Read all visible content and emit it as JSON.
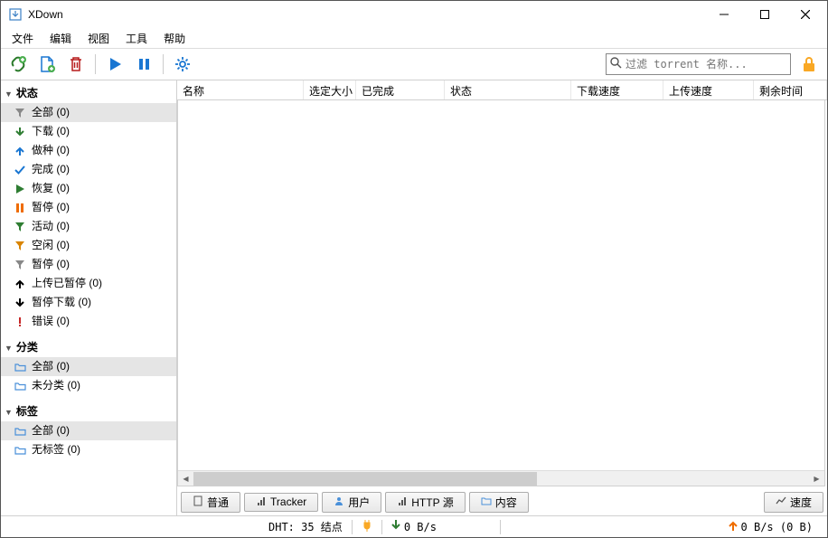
{
  "title": "XDown",
  "menu": {
    "file": "文件",
    "edit": "编辑",
    "view": "视图",
    "tools": "工具",
    "help": "帮助"
  },
  "search": {
    "placeholder": "过滤 torrent 名称..."
  },
  "sidebar": {
    "status_header": "状态",
    "status": [
      {
        "label": "全部 (0)",
        "icon": "filter-gray",
        "sel": true
      },
      {
        "label": "下载 (0)",
        "icon": "arrow-down-green"
      },
      {
        "label": "做种 (0)",
        "icon": "arrow-up-blue"
      },
      {
        "label": "完成 (0)",
        "icon": "check-blue"
      },
      {
        "label": "恢复 (0)",
        "icon": "play-green"
      },
      {
        "label": "暂停 (0)",
        "icon": "pause-orange"
      },
      {
        "label": "活动 (0)",
        "icon": "filter-green"
      },
      {
        "label": "空闲 (0)",
        "icon": "filter-orange"
      },
      {
        "label": "暂停 (0)",
        "icon": "filter-gray"
      },
      {
        "label": "上传已暂停 (0)",
        "icon": "arrow-up-black"
      },
      {
        "label": "暂停下载 (0)",
        "icon": "arrow-down-black"
      },
      {
        "label": "错误 (0)",
        "icon": "excl-red"
      }
    ],
    "cat_header": "分类",
    "cat": [
      {
        "label": "全部 (0)",
        "icon": "folder",
        "sel": true
      },
      {
        "label": "未分类 (0)",
        "icon": "folder"
      }
    ],
    "tag_header": "标签",
    "tag": [
      {
        "label": "全部 (0)",
        "icon": "folder",
        "sel": true
      },
      {
        "label": "无标签 (0)",
        "icon": "folder"
      }
    ]
  },
  "columns": {
    "name": "名称",
    "size": "选定大小",
    "done": "已完成",
    "status": "状态",
    "dlspeed": "下载速度",
    "upspeed": "上传速度",
    "eta": "剩余时间"
  },
  "bottom_tabs": {
    "general": "普通",
    "tracker": "Tracker",
    "peers": "用户",
    "http": "HTTP 源",
    "content": "内容",
    "speed": "速度"
  },
  "status_bar": {
    "dht": "DHT: 35 结点",
    "dl": "0 B/s",
    "ul": "0 B/s (0 B)"
  }
}
